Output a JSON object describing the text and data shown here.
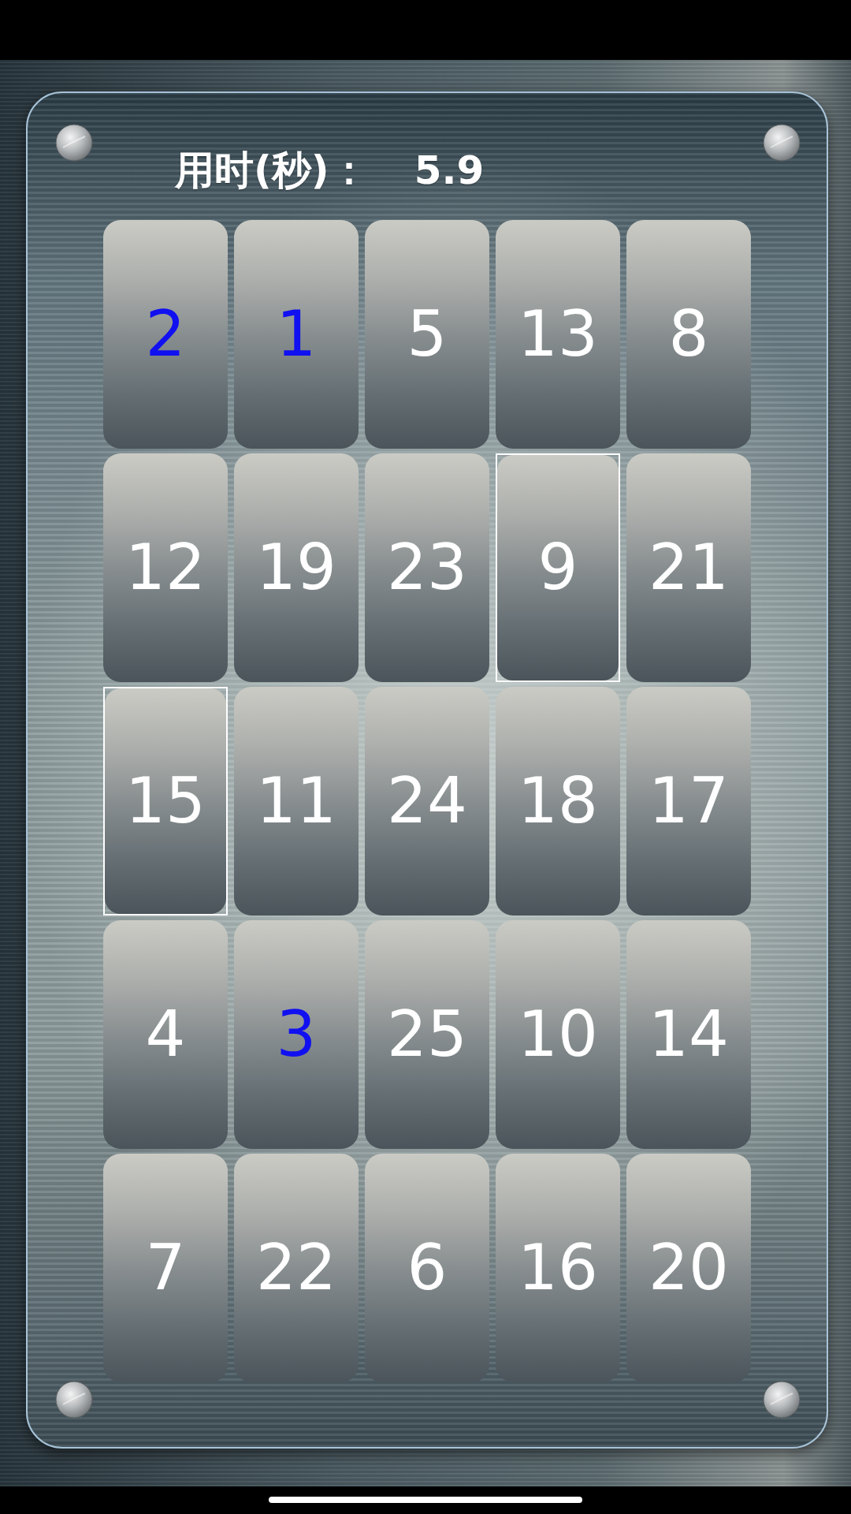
{
  "timer": {
    "label": "用时(秒)：",
    "value": "5.9"
  },
  "tiles": [
    {
      "number": "2",
      "found": true,
      "selected": false
    },
    {
      "number": "1",
      "found": true,
      "selected": false
    },
    {
      "number": "5",
      "found": false,
      "selected": false
    },
    {
      "number": "13",
      "found": false,
      "selected": false
    },
    {
      "number": "8",
      "found": false,
      "selected": false
    },
    {
      "number": "12",
      "found": false,
      "selected": false
    },
    {
      "number": "19",
      "found": false,
      "selected": false
    },
    {
      "number": "23",
      "found": false,
      "selected": false
    },
    {
      "number": "9",
      "found": false,
      "selected": true
    },
    {
      "number": "21",
      "found": false,
      "selected": false
    },
    {
      "number": "15",
      "found": false,
      "selected": true
    },
    {
      "number": "11",
      "found": false,
      "selected": false
    },
    {
      "number": "24",
      "found": false,
      "selected": false
    },
    {
      "number": "18",
      "found": false,
      "selected": false
    },
    {
      "number": "17",
      "found": false,
      "selected": false
    },
    {
      "number": "4",
      "found": false,
      "selected": false
    },
    {
      "number": "3",
      "found": true,
      "selected": false
    },
    {
      "number": "25",
      "found": false,
      "selected": false
    },
    {
      "number": "10",
      "found": false,
      "selected": false
    },
    {
      "number": "14",
      "found": false,
      "selected": false
    },
    {
      "number": "7",
      "found": false,
      "selected": false
    },
    {
      "number": "22",
      "found": false,
      "selected": false
    },
    {
      "number": "6",
      "found": false,
      "selected": false
    },
    {
      "number": "16",
      "found": false,
      "selected": false
    },
    {
      "number": "20",
      "found": false,
      "selected": false
    }
  ]
}
